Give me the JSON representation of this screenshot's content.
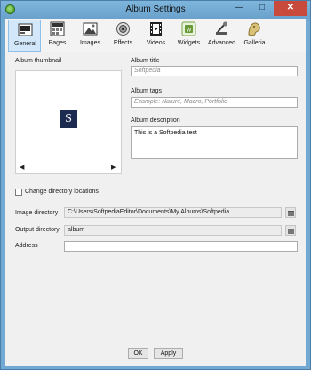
{
  "window": {
    "title": "Album Settings",
    "close_glyph": "✕",
    "min_glyph": "—",
    "max_glyph": "□"
  },
  "tabs": [
    {
      "label": "General",
      "icon": "general-icon"
    },
    {
      "label": "Pages",
      "icon": "pages-icon"
    },
    {
      "label": "Images",
      "icon": "images-icon"
    },
    {
      "label": "Effects",
      "icon": "effects-icon"
    },
    {
      "label": "Videos",
      "icon": "videos-icon"
    },
    {
      "label": "Widgets",
      "icon": "widgets-icon"
    },
    {
      "label": "Advanced",
      "icon": "advanced-icon"
    },
    {
      "label": "Galleria",
      "icon": "galleria-icon"
    }
  ],
  "general": {
    "thumbnail_label": "Album thumbnail",
    "thumbnail_glyph": "S",
    "prev_glyph": "◀",
    "next_glyph": "▶",
    "title_label": "Album title",
    "title_placeholder": "Softpedia",
    "tags_label": "Album tags",
    "tags_placeholder": "Example: Nature, Macro, Portfolio",
    "desc_label": "Album description",
    "desc_value": "This is a Softpedia test",
    "change_dir_label": "Change directory locations",
    "image_dir_label": "Image directory",
    "image_dir_value": "C:\\Users\\SoftpediaEditor\\Documents\\My Albums\\Softpedia",
    "output_dir_label": "Output directory",
    "output_dir_value": "album",
    "address_label": "Address",
    "address_value": ""
  },
  "buttons": {
    "ok": "OK",
    "apply": "Apply"
  }
}
